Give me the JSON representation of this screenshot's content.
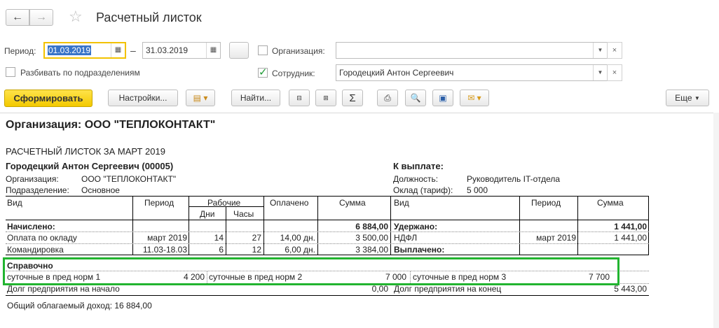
{
  "window": {
    "title": "Расчетный листок"
  },
  "filters": {
    "period_label": "Период:",
    "date_from": "01.03.2019",
    "date_sep": "–",
    "date_to": "31.03.2019",
    "more_button": "...",
    "split_label": "Разбивать по подразделениям",
    "org_label": "Организация:",
    "org_value": "",
    "employee_label": "Сотрудник:",
    "employee_value": "Городецкий Антон Сергеевич"
  },
  "toolbar": {
    "generate": "Сформировать",
    "settings": "Настройки...",
    "find": "Найти...",
    "more": "Еще",
    "sum_icon": "Σ"
  },
  "report": {
    "org_title": "Организация: ООО \"ТЕПЛОКОНТАКТ\"",
    "sheet_title": "РАСЧЕТНЫЙ ЛИСТОК ЗА МАРТ 2019",
    "employee_name": "Городецкий Антон Сергеевич (00005)",
    "to_pay_label": "К выплате:",
    "org_row_label": "Организация:",
    "org_row_value": "ООО \"ТЕПЛОКОНТАКТ\"",
    "dept_label": "Подразделение:",
    "dept_value": "Основное",
    "position_label": "Должность:",
    "position_value": "Руководитель IT-отдела",
    "salary_label": "Оклад (тариф):",
    "salary_value": "5 000",
    "headers": {
      "kind": "Вид",
      "period": "Период",
      "working": "Рабочие",
      "days": "Дни",
      "hours": "Часы",
      "paid": "Оплачено",
      "sum": "Сумма",
      "kind2": "Вид",
      "period2": "Период",
      "sum2": "Сумма"
    },
    "accrued_label": "Начислено:",
    "accrued_total": "6 884,00",
    "withheld_label": "Удержано:",
    "withheld_total": "1 441,00",
    "rows": [
      {
        "kind": "Оплата по окладу",
        "period": "март 2019",
        "days": "14",
        "hours": "27",
        "paid": "14,00 дн.",
        "sum": "3 500,00"
      },
      {
        "kind": "Командировка",
        "period": "11.03-18.03",
        "days": "6",
        "hours": "12",
        "paid": "6,00 дн.",
        "sum": "3 384,00"
      }
    ],
    "withheld_row": {
      "kind": "НДФЛ",
      "period": "март 2019",
      "sum": "1 441,00"
    },
    "paid_out_label": "Выплачено:",
    "reference_label": "Справочно",
    "reference": [
      {
        "name": "суточные в пред норм 1",
        "value": "4 200"
      },
      {
        "name": "суточные в пред норм 2",
        "value": "7 000"
      },
      {
        "name": "суточные в пред норм 3",
        "value": "7 700"
      }
    ],
    "debt_start_label": "Долг предприятия на начало",
    "debt_start_value": "0,00",
    "debt_end_label": "Долг предприятия на конец",
    "debt_end_value": "5 443,00",
    "taxable_income": "Общий облагаемый доход: 16 884,00"
  }
}
